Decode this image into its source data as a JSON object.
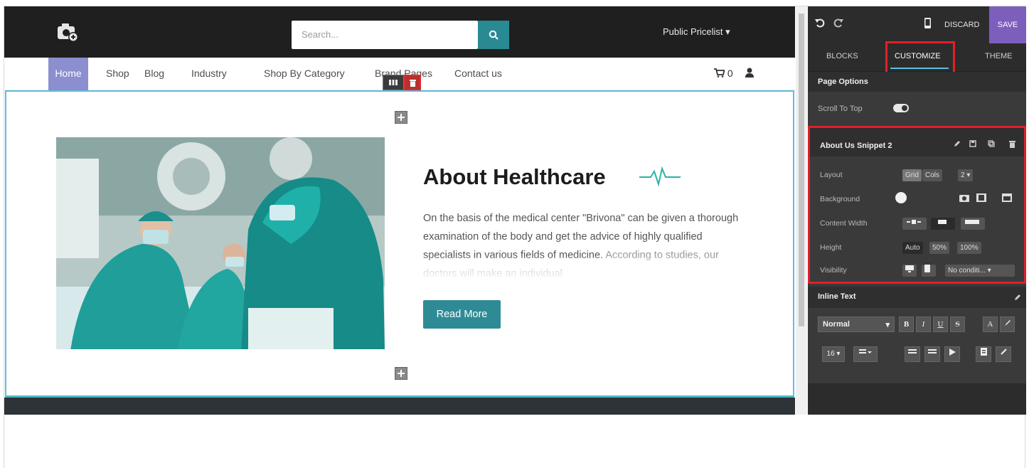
{
  "site": {
    "search_placeholder": "Search...",
    "pricelist_label": "Public Pricelist ▾",
    "nav": [
      "Home",
      "Shop",
      "Blog",
      "Industry",
      "Shop By Category",
      "Brand Pages",
      "Contact us"
    ],
    "cart_count": "0",
    "about": {
      "title": "About Healthcare",
      "text": "On the basis of the medical center \"Brivona\" can be given a thorough examination of the body and get the advice of highly qualified specialists in various fields of medicine.",
      "text_faded": "According to studies, our doctors will make an individual",
      "button": "Read More"
    },
    "accent_color": "#2e8b95",
    "nav_active_color": "#8b8fcf"
  },
  "panel": {
    "discard": "DISCARD",
    "save": "SAVE",
    "tabs": [
      "BLOCKS",
      "CUSTOMIZE",
      "THEME"
    ],
    "page_options": "Page Options",
    "scroll_to_top": "Scroll To Top",
    "snippet": {
      "title": "About Us Snippet 2",
      "layout_label": "Layout",
      "layout_grid": "Grid",
      "layout_cols": "Cols",
      "layout_cols_value": "2 ▾",
      "background_label": "Background",
      "content_width_label": "Content Width",
      "height_label": "Height",
      "height_options": [
        "Auto",
        "50%",
        "100%"
      ],
      "visibility_label": "Visibility",
      "visibility_value": "No conditi... ▾"
    },
    "inline_text": "Inline Text",
    "format_value": "Normal",
    "font_size": "16 ▾"
  }
}
